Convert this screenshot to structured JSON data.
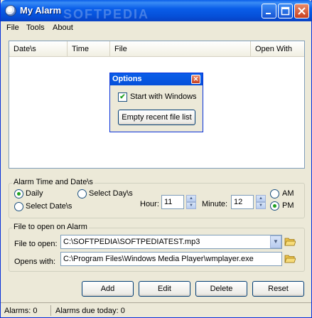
{
  "window": {
    "title": "My Alarm",
    "watermark": "SOFTPEDIA"
  },
  "menu": [
    "File",
    "Tools",
    "About"
  ],
  "list": {
    "columns": [
      "Date\\s",
      "Time",
      "File",
      "Open With"
    ]
  },
  "options": {
    "title": "Options",
    "start_with_windows": {
      "label": "Start with Windows",
      "checked": true
    },
    "empty_recent_label": "Empty recent file list"
  },
  "alarm_time": {
    "group_title": "Alarm Time and Date\\s",
    "daily": {
      "label": "Daily",
      "selected": true
    },
    "select_days": {
      "label": "Select Day\\s",
      "selected": false
    },
    "select_dates": {
      "label": "Select Date\\s",
      "selected": false
    },
    "hour_label": "Hour:",
    "hour_value": "11",
    "minute_label": "Minute:",
    "minute_value": "12",
    "am": {
      "label": "AM",
      "selected": false
    },
    "pm": {
      "label": "PM",
      "selected": true
    }
  },
  "file_group": {
    "group_title": "File to open on Alarm",
    "file_label": "File to open:",
    "file_value": "C:\\SOFTPEDIA\\SOFTPEDIATEST.mp3",
    "opens_label": "Opens with:",
    "opens_value": "C:\\Program Files\\Windows Media Player\\wmplayer.exe"
  },
  "buttons": {
    "add": "Add",
    "edit": "Edit",
    "delete": "Delete",
    "reset": "Reset"
  },
  "status": {
    "alarms": "Alarms: 0",
    "due_today": "Alarms due today: 0"
  },
  "colors": {
    "titlebar": "#0a5ee9",
    "face": "#ece9d8",
    "radio_dot": "#21a121"
  }
}
